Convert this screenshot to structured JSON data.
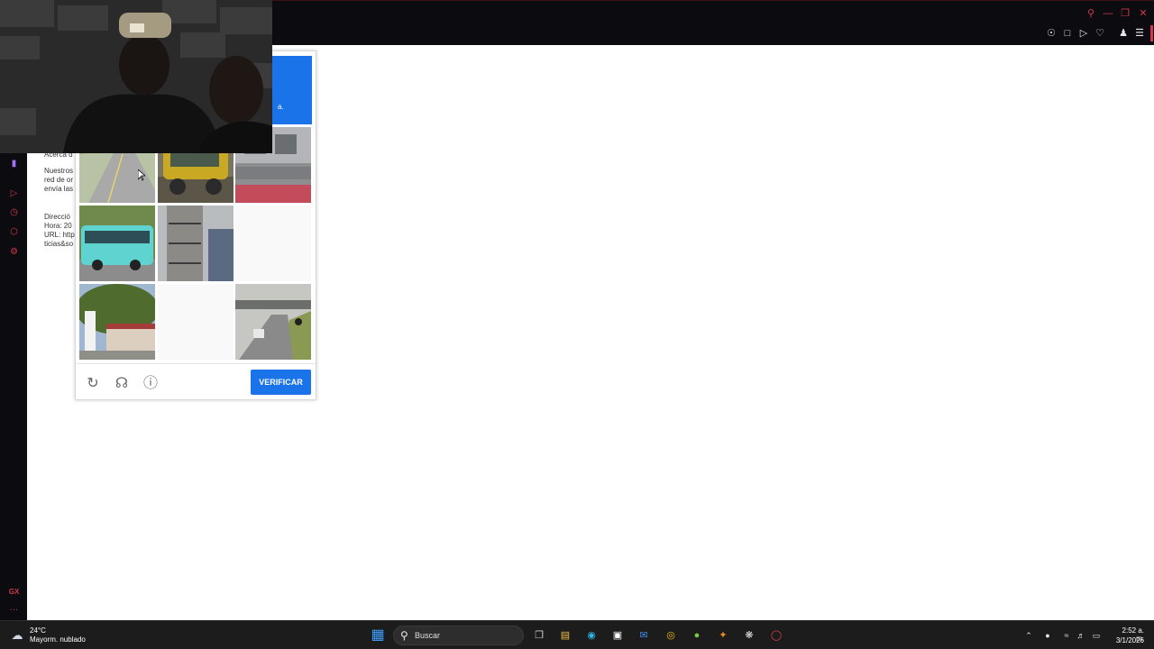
{
  "browser": {
    "window_controls": [
      "search-icon",
      "minimize-icon",
      "restore-icon",
      "close-icon"
    ],
    "toolbar_icons": [
      "pin-icon",
      "snapshot-icon",
      "play-icon",
      "heart-icon",
      "account-icon",
      "menu-icon"
    ],
    "sidebar_icons": [
      "twitch-icon",
      "player-icon",
      "history-icon",
      "extensions-icon",
      "settings-icon",
      "gx-icon",
      "more-icon"
    ],
    "sidebar_gx_label": "GX",
    "sidebar_more_label": "···"
  },
  "page": {
    "snippet1": "Acerca d",
    "snippet2": "Nuestros\nred de or\nenvía las",
    "snippet3": "Direcció\nHora: 20\nURL: http\nticias&so"
  },
  "captcha": {
    "header_text": "a.",
    "verify_label": "VERIFICAR",
    "icons": [
      "reload-icon",
      "audio-icon",
      "info-icon"
    ],
    "tiles": [
      {
        "name": "road-tile",
        "blank": false
      },
      {
        "name": "rickshaw-tile",
        "blank": false
      },
      {
        "name": "building-tile",
        "blank": false
      },
      {
        "name": "bus-tile",
        "blank": false
      },
      {
        "name": "fire-escape-tile",
        "blank": false
      },
      {
        "name": "blank-tile",
        "blank": true
      },
      {
        "name": "house-tile",
        "blank": false
      },
      {
        "name": "blank-tile",
        "blank": true
      },
      {
        "name": "bridge-road-tile",
        "blank": false
      }
    ]
  },
  "taskbar": {
    "weather_temp": "24°C",
    "weather_desc": "Mayorm. nublado",
    "search_placeholder": "Buscar",
    "apps": [
      "windows-start-icon",
      "task-view-icon",
      "file-explorer-icon",
      "edge-icon",
      "store-icon",
      "outlook-icon",
      "chrome-icon",
      "utorrent-icon",
      "fl-studio-icon",
      "chatgpt-icon",
      "opera-gx-icon"
    ],
    "tray": [
      "chevron-up-icon",
      "microphone-icon",
      "wifi-icon",
      "volume-icon",
      "battery-icon"
    ],
    "time": "2:52 a. m.",
    "date": "3/1/2026"
  },
  "colors": {
    "accent_blue": "#1a73e8",
    "opera_red": "#d2374f",
    "chrome_bg": "#0c0c10",
    "taskbar_bg": "#1c1c1c"
  }
}
